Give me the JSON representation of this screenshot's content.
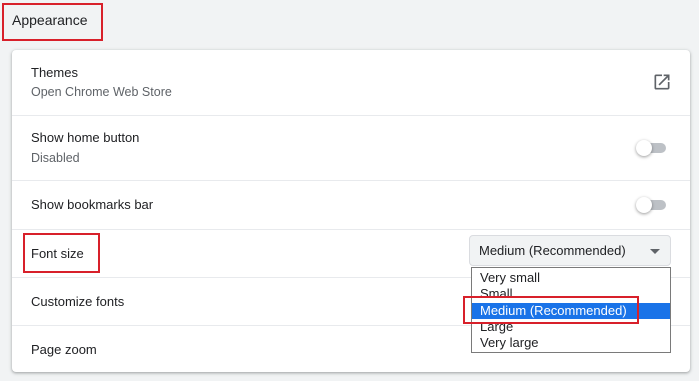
{
  "section": {
    "title": "Appearance"
  },
  "themes": {
    "label": "Themes",
    "sublabel": "Open Chrome Web Store",
    "icon": "external-link-icon"
  },
  "home_button": {
    "label": "Show home button",
    "sublabel": "Disabled",
    "enabled": false
  },
  "bookmarks_bar": {
    "label": "Show bookmarks bar",
    "enabled": false
  },
  "font_size": {
    "label": "Font size",
    "selected": "Medium (Recommended)",
    "options": [
      "Very small",
      "Small",
      "Medium (Recommended)",
      "Large",
      "Very large"
    ]
  },
  "customize_fonts": {
    "label": "Customize fonts"
  },
  "page_zoom": {
    "label": "Page zoom"
  },
  "colors": {
    "highlight": "#d8202a",
    "selection": "#1a73e8",
    "toggle_off": "#bdc1c6"
  }
}
